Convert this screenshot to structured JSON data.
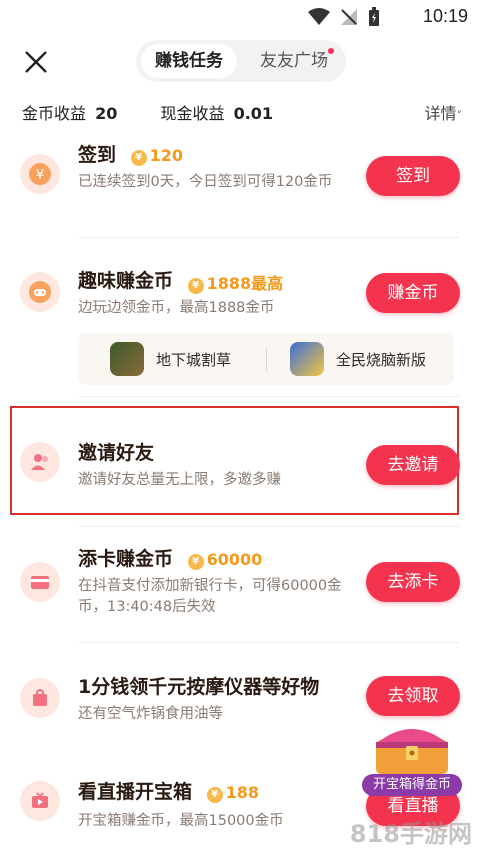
{
  "status": {
    "time": "10:19"
  },
  "header": {
    "tabs": [
      "赚钱任务",
      "友友广场"
    ]
  },
  "earnings": {
    "coin_label": "金币收益",
    "coin_value": "20",
    "cash_label": "现金收益",
    "cash_value": "0.01",
    "details": "详情"
  },
  "tasks": [
    {
      "title": "签到",
      "badge": "120",
      "sub": "已连续签到0天，今日签到可得120金币",
      "cta": "签到",
      "icon": "yen-coin-icon"
    },
    {
      "title": "趣味赚金币",
      "badge": "1888最高",
      "sub": "边玩边领金币，最高1888金币",
      "cta": "赚金币",
      "icon": "gamepad-icon"
    },
    {
      "title": "邀请好友",
      "badge": "",
      "sub": "邀请好友总量无上限，多邀多赚",
      "cta": "去邀请",
      "icon": "friends-icon"
    },
    {
      "title": "添卡赚金币",
      "badge": "60000",
      "sub": "在抖音支付添加新银行卡，可得60000金币，13:40:48后失效",
      "cta": "去添卡",
      "icon": "card-icon"
    },
    {
      "title": "1分钱领千元按摩仪器等好物",
      "badge": "",
      "sub": "还有空气炸锅食用油等",
      "cta": "去领取",
      "icon": "bag-icon"
    },
    {
      "title": "看直播开宝箱",
      "badge": "188",
      "sub": "开宝箱赚金币，最高15000金币",
      "cta": "看直播",
      "icon": "tv-icon"
    }
  ],
  "games": [
    "地下城割草",
    "全民烧脑新版"
  ],
  "treasure": {
    "label": "开宝箱得金币"
  },
  "watermark": "818手游网",
  "colors": {
    "accent": "#f4344f",
    "badge": "#f29a1b",
    "highlight": "#d9302d"
  }
}
